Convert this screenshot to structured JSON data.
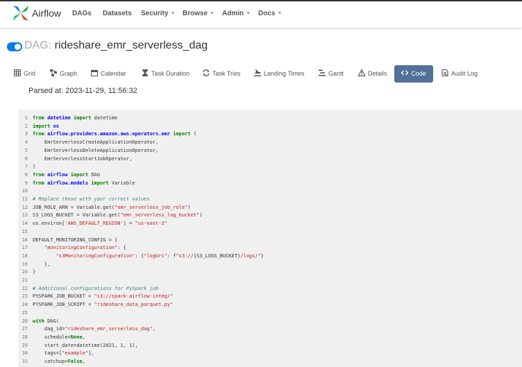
{
  "navbar": {
    "brand": "Airflow",
    "items": [
      {
        "label": "DAGs",
        "dropdown": false
      },
      {
        "label": "Datasets",
        "dropdown": false
      },
      {
        "label": "Security",
        "dropdown": true
      },
      {
        "label": "Browse",
        "dropdown": true
      },
      {
        "label": "Admin",
        "dropdown": true
      },
      {
        "label": "Docs",
        "dropdown": true
      }
    ]
  },
  "dag": {
    "prefix": "DAG:",
    "name": "rideshare_emr_serverless_dag",
    "toggle_on": true
  },
  "tabs": [
    {
      "label": "Grid",
      "icon": "grid-icon"
    },
    {
      "label": "Graph",
      "icon": "graph-icon"
    },
    {
      "label": "Calendar",
      "icon": "calendar-icon"
    },
    {
      "label": "Task Duration",
      "icon": "hourglass-icon"
    },
    {
      "label": "Task Tries",
      "icon": "retry-icon"
    },
    {
      "label": "Landing Times",
      "icon": "landing-icon"
    },
    {
      "label": "Gantt",
      "icon": "gantt-icon"
    },
    {
      "label": "Details",
      "icon": "warning-icon"
    },
    {
      "label": "Code",
      "icon": "code-icon",
      "active": true
    },
    {
      "label": "Audit Log",
      "icon": "audit-log-icon"
    }
  ],
  "parsed_at": "Parsed at: 2023-11-29, 11:56:32",
  "colors": {
    "active_tab": "#51709a",
    "toggle": "#017cee",
    "code_background": "#f0f0f0"
  },
  "code_lines": [
    [
      [
        "kw",
        "from "
      ],
      [
        "mod",
        "datetime"
      ],
      [
        "kw",
        " import "
      ],
      [
        "",
        "datetime"
      ]
    ],
    [
      [
        "kw",
        "import "
      ],
      [
        "mod",
        "os"
      ]
    ],
    [
      [
        "kw",
        "from "
      ],
      [
        "mod",
        "airflow.providers.amazon.aws.operators.emr"
      ],
      [
        "kw",
        " import "
      ],
      [
        "",
        "("
      ]
    ],
    [
      [
        "",
        "    EmrServerlessCreateApplicationOperator,"
      ]
    ],
    [
      [
        "",
        "    EmrServerlessDeleteApplicationOperator,"
      ]
    ],
    [
      [
        "",
        "    EmrServerlessStartJobOperator,"
      ]
    ],
    [
      [
        "",
        ")"
      ]
    ],
    [
      [
        "kw",
        "from "
      ],
      [
        "mod",
        "airflow"
      ],
      [
        "kw",
        " import "
      ],
      [
        "",
        "DAG"
      ]
    ],
    [
      [
        "kw",
        "from "
      ],
      [
        "mod",
        "airflow.models"
      ],
      [
        "kw",
        " import "
      ],
      [
        "",
        "Variable"
      ]
    ],
    [],
    [
      [
        "cm",
        "# Replace these with your correct values"
      ]
    ],
    [
      [
        "",
        "JOB_ROLE_ARN = Variable.get("
      ],
      [
        "str",
        "\"emr_serverless_job_role\""
      ],
      [
        "",
        ")"
      ]
    ],
    [
      [
        "",
        "S3_LOGS_BUCKET = Variable.get("
      ],
      [
        "str",
        "\"emr_serverless_log_bucket\""
      ],
      [
        "",
        ")"
      ]
    ],
    [
      [
        "",
        "os.environ["
      ],
      [
        "str",
        "'AWS_DEFAULT_REGION'"
      ],
      [
        "",
        "] = "
      ],
      [
        "str",
        "\"us-east-2\""
      ]
    ],
    [],
    [
      [
        "",
        "DEFAULT_MONITORING_CONFIG = {"
      ]
    ],
    [
      [
        "",
        "    "
      ],
      [
        "str",
        "\"monitoringConfiguration\""
      ],
      [
        "",
        ": {"
      ]
    ],
    [
      [
        "",
        "        "
      ],
      [
        "str",
        "\"s3MonitoringConfiguration\""
      ],
      [
        "",
        ": {"
      ],
      [
        "str",
        "\"logUri\""
      ],
      [
        "",
        ": f"
      ],
      [
        "str",
        "\"s3://"
      ],
      [
        "",
        "{S3_LOGS_BUCKET}"
      ],
      [
        "str",
        "/logs/\""
      ],
      [
        "",
        "}"
      ]
    ],
    [
      [
        "",
        "    },"
      ]
    ],
    [
      [
        "",
        "}"
      ]
    ],
    [],
    [
      [
        "cm",
        "# Additional configurations for PySpark job"
      ]
    ],
    [
      [
        "",
        "PYSPARK_JOB_BUCKET = "
      ],
      [
        "str",
        "\"s3://spark-airflow-integ/\""
      ]
    ],
    [
      [
        "",
        "PYSPARK_JOB_SCRIPT = "
      ],
      [
        "str",
        "\"rideshare_data_parquet.py\""
      ]
    ],
    [],
    [
      [
        "kw",
        "with "
      ],
      [
        "",
        "DAG("
      ]
    ],
    [
      [
        "",
        "    dag_id="
      ],
      [
        "str",
        "\"rideshare_emr_serverless_dag\""
      ],
      [
        "",
        ","
      ]
    ],
    [
      [
        "",
        "    schedule="
      ],
      [
        "kw",
        "None"
      ],
      [
        "",
        ","
      ]
    ],
    [
      [
        "",
        "    start_date=datetime(2021, 1, 1),"
      ]
    ],
    [
      [
        "",
        "    tags=["
      ],
      [
        "str",
        "\"example\""
      ],
      [
        "",
        "],"
      ]
    ],
    [
      [
        "",
        "    catchup="
      ],
      [
        "kw",
        "False"
      ],
      [
        "",
        ","
      ]
    ]
  ]
}
